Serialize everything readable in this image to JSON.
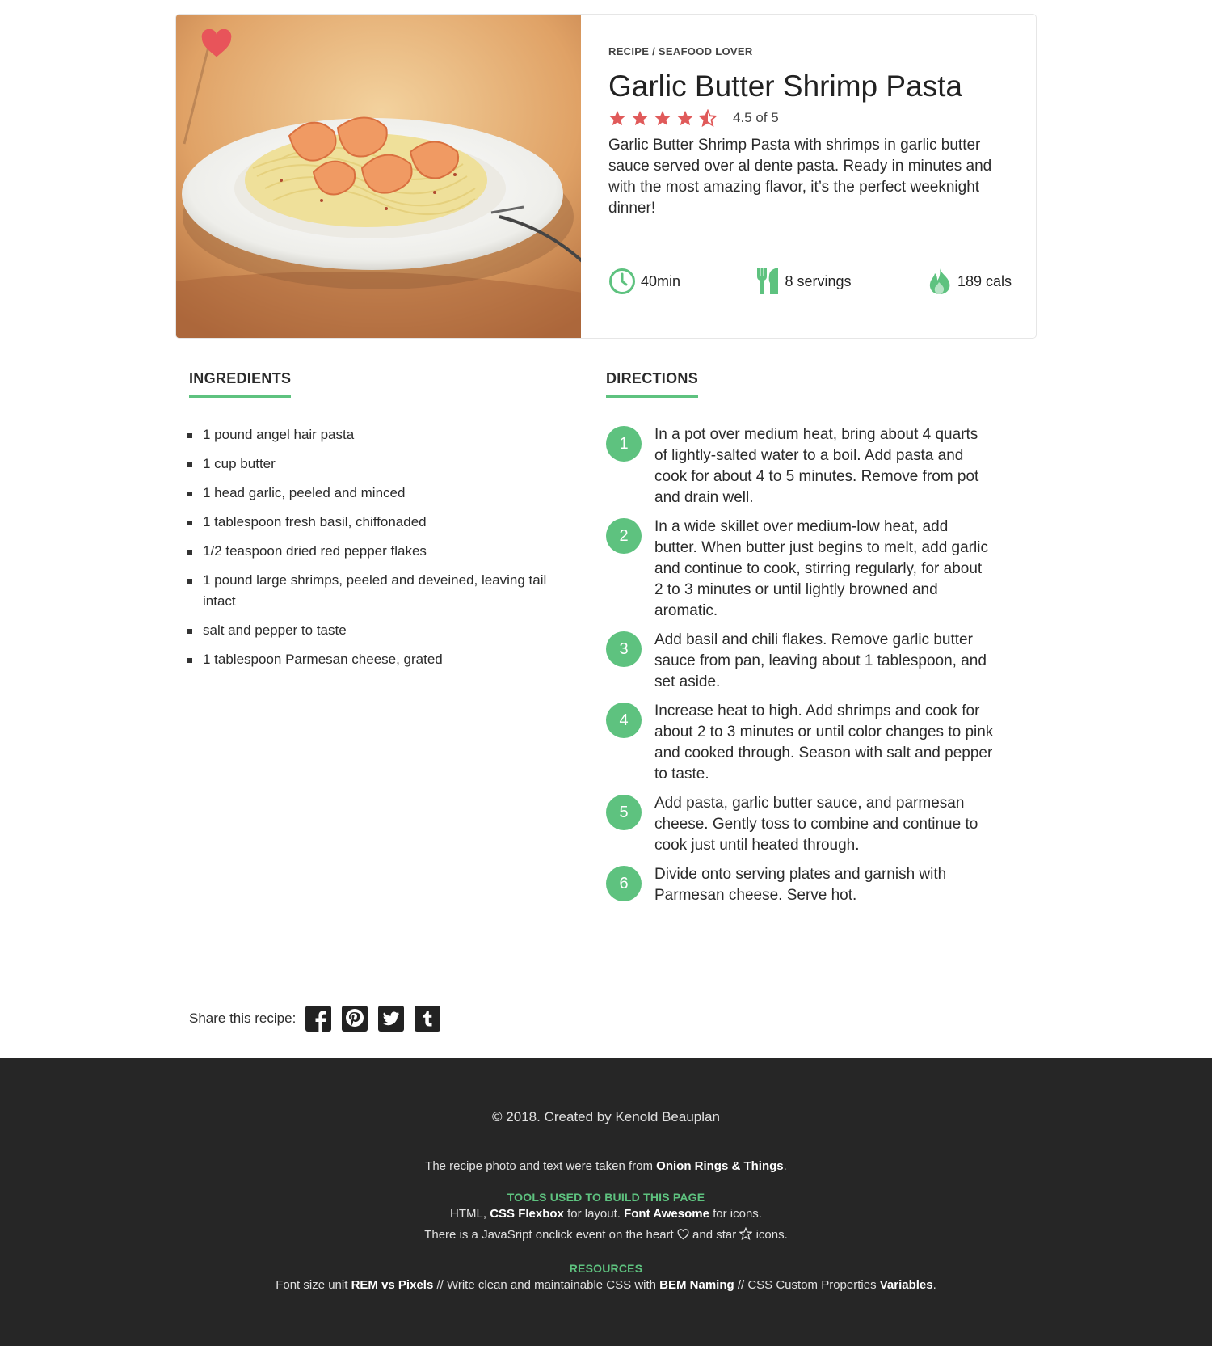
{
  "recipe": {
    "breadcrumb": "RECIPE / SEAFOOD LOVER",
    "title": "Garlic Butter Shrimp Pasta",
    "rating_text": "4.5 of 5",
    "description": "Garlic Butter Shrimp Pasta with shrimps in garlic butter sauce served over al dente pasta. Ready in minutes and with the most amazing flavor, it’s the perfect weeknight dinner!",
    "time": "40min",
    "servings": "8 servings",
    "calories": "189 cals",
    "rating_value": 4.5
  },
  "ingredients": {
    "title": "INGREDIENTS",
    "items": [
      "1 pound angel hair pasta",
      "1 cup butter",
      "1 head garlic, peeled and minced",
      "1 tablespoon fresh basil, chiffonaded",
      "1/2 teaspoon dried red pepper flakes",
      "1 pound large shrimps, peeled and deveined, leaving tail intact",
      "salt and pepper to taste",
      "1 tablespoon Parmesan cheese, grated"
    ]
  },
  "directions": {
    "title": "DIRECTIONS",
    "steps": [
      {
        "num": "1",
        "text": "In a pot over medium heat, bring about 4 quarts of lightly-salted water to a boil. Add pasta and cook for about 4 to 5 minutes. Remove from pot and drain well."
      },
      {
        "num": "2",
        "text": "In a wide skillet over medium-low heat, add butter. When butter just begins to melt, add garlic and continue to cook, stirring regularly, for about 2 to 3 minutes or until lightly browned and aromatic."
      },
      {
        "num": "3",
        "text": "Add basil and chili flakes. Remove garlic butter sauce from pan, leaving about 1 tablespoon, and set aside."
      },
      {
        "num": "4",
        "text": "Increase heat to high. Add shrimps and cook for about 2 to 3 minutes or until color changes to pink and cooked through. Season with salt and pepper to taste."
      },
      {
        "num": "5",
        "text": "Add pasta, garlic butter sauce, and parmesan cheese. Gently toss to combine and continue to cook just until heated through."
      },
      {
        "num": "6",
        "text": "Divide onto serving plates and garnish with Parmesan cheese. Serve hot."
      }
    ]
  },
  "share": {
    "label": "Share this recipe:",
    "icons": [
      "facebook-icon",
      "pinterest-icon",
      "twitter-icon",
      "tumblr-icon"
    ]
  },
  "footer": {
    "copyright": "© 2018. Created by Kenold Beauplan",
    "credit_prefix": "The recipe photo and text were taken from ",
    "credit_link": "Onion Rings & Things",
    "credit_suffix": ".",
    "tools_title": "TOOLS USED TO BUILD THIS PAGE",
    "tools_line1_a": "HTML, ",
    "tools_link1": "CSS Flexbox",
    "tools_line1_b": " for layout. ",
    "tools_link2": "Font Awesome",
    "tools_line1_c": " for icons.",
    "tools_line2_a": "There is a JavaSript onclick event on the heart ",
    "tools_line2_b": " and star ",
    "tools_line2_c": " icons.",
    "resources_title": "RESOURCES",
    "res_a": "Font size unit ",
    "res_link1": "REM vs Pixels",
    "res_b": " // Write clean and maintainable CSS with ",
    "res_link2": "BEM Naming",
    "res_c": " // CSS Custom Properties ",
    "res_link3": "Variables",
    "res_d": "."
  },
  "colors": {
    "accent_green": "#5ec27f",
    "star_red": "#e05a5a",
    "heart_red": "#e8545a",
    "footer_bg": "#262626"
  }
}
